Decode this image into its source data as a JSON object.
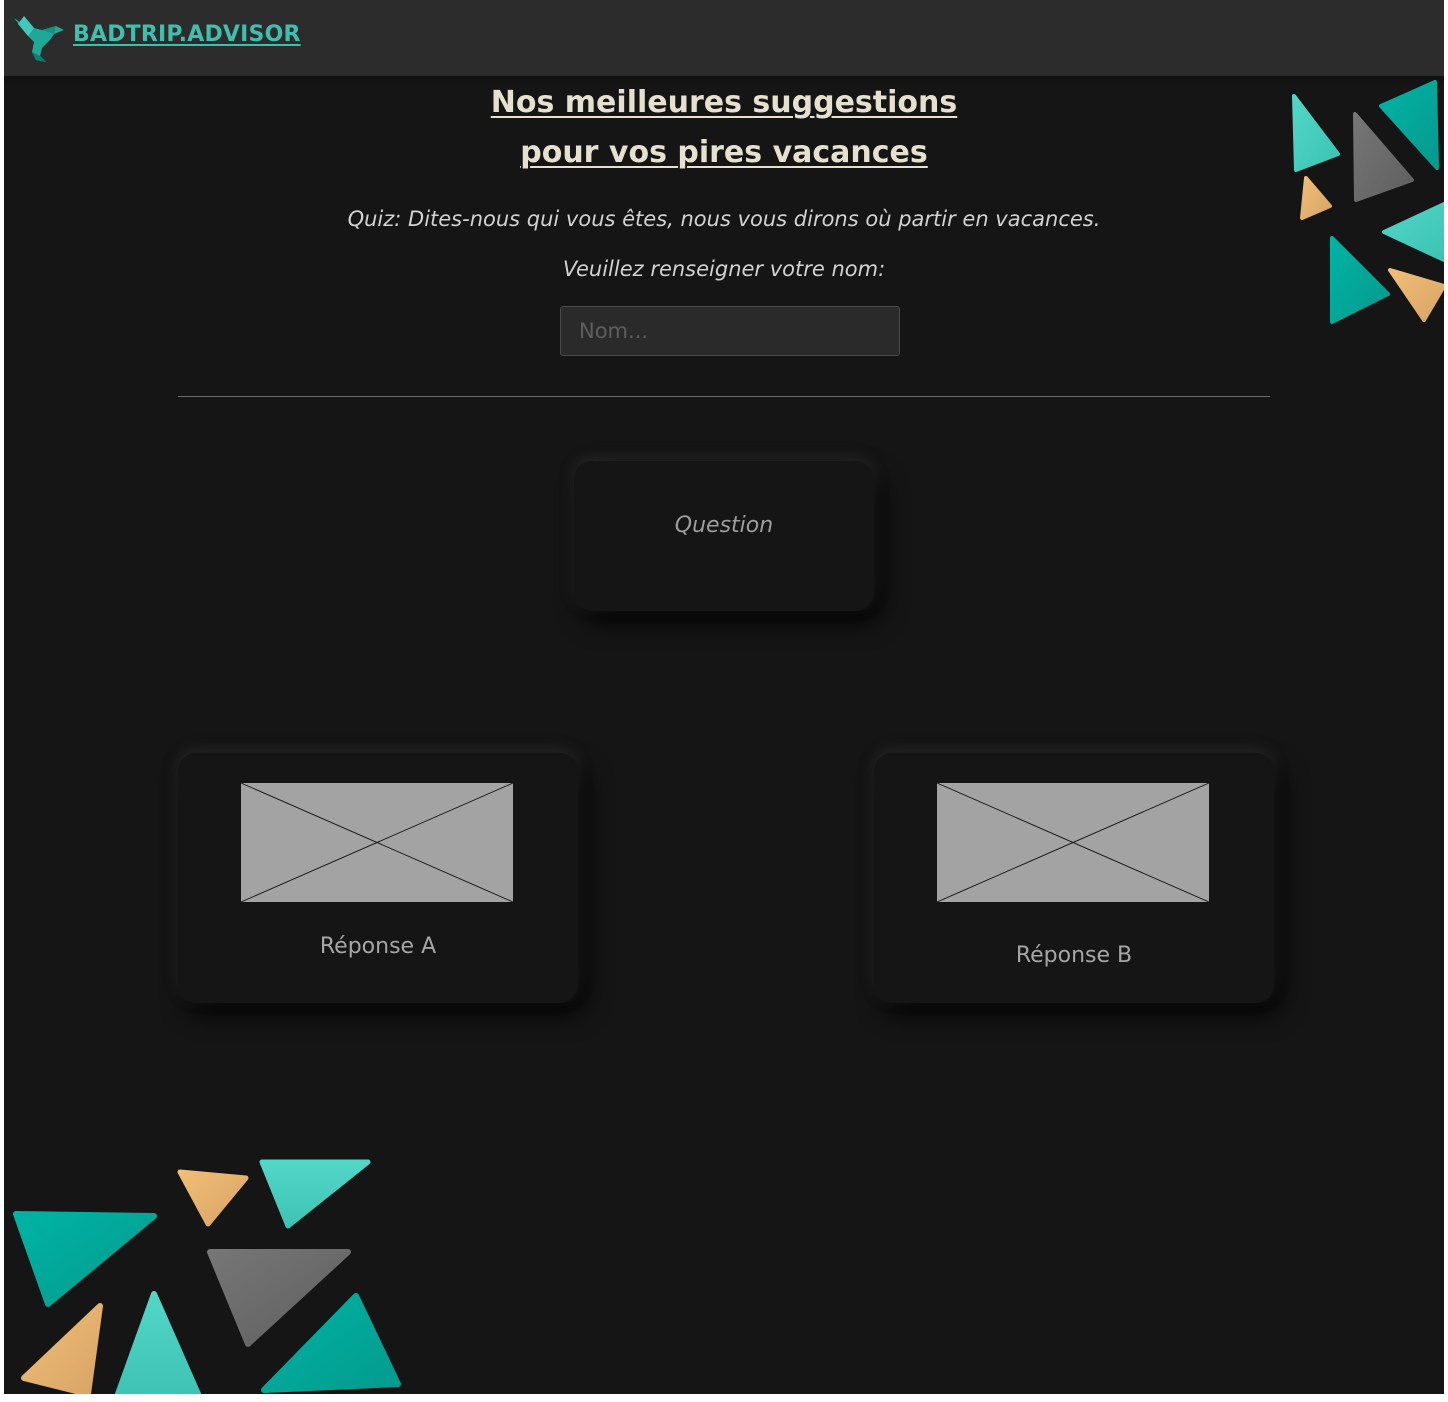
{
  "header": {
    "brand": "BADTRIP.ADVISOR",
    "logo_icon": "hummingbird-icon"
  },
  "hero": {
    "title_line1": "Nos meilleures suggestions",
    "title_line2": "pour vos pires vacances",
    "subtitle": "Quiz: Dites-nous qui vous êtes, nous vous dirons où partir en vacances.",
    "name_label": "Veuillez renseigner votre nom:",
    "name_placeholder": "Nom...",
    "name_value": ""
  },
  "quiz": {
    "question": "Question",
    "answers": [
      {
        "label": "Réponse A",
        "image": "image-placeholder"
      },
      {
        "label": "Réponse B",
        "image": "image-placeholder"
      }
    ]
  },
  "colors": {
    "background": "#151515",
    "header": "#2c2c2c",
    "brand_teal": "#3fbfae",
    "title": "#e6e0cf",
    "triangle_teal_dark": "#00a99d",
    "triangle_teal_light": "#4fd3c4",
    "triangle_gray": "#6b6b6b",
    "triangle_orange": "#e8b36e"
  }
}
